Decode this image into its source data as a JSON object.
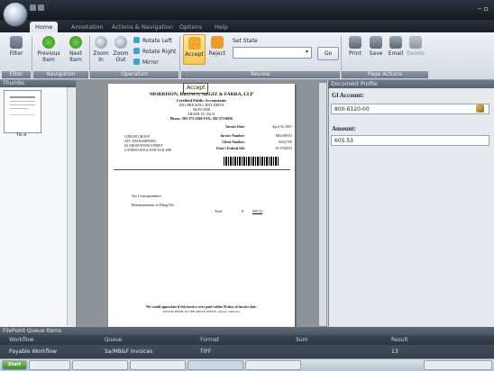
{
  "window": {
    "controls": "– ▫"
  },
  "tabs": [
    {
      "label": "Home"
    },
    {
      "label": "Annotation"
    },
    {
      "label": "Actions & Navigation"
    },
    {
      "label": "Options"
    },
    {
      "label": "Help"
    }
  ],
  "ribbon": {
    "groups": {
      "filter": "Filter",
      "navigation": "Navigation",
      "operation": "Operation",
      "review": "Review",
      "page_actions": "Page Actions"
    },
    "filter_label": "Filter",
    "previous_label": "Previous Item",
    "next_label": "Next Item",
    "zoom_in_label": "Zoom In",
    "zoom_out_label": "Zoom Out",
    "rotate_left_label": "Rotate Left",
    "rotate_right_label": "Rotate Right",
    "mirror_label": "Mirror",
    "accept_label": "Accept",
    "reject_label": "Reject",
    "set_state_label": "Set State",
    "go_label": "Go",
    "print_label": "Print",
    "save_label": "Save",
    "email_label": "Email",
    "delete_label": "Delete"
  },
  "thumbnails": {
    "header": "Thumbs",
    "item_label": "fa-a"
  },
  "tooltip": "Accept",
  "document": {
    "firm": "MORRISON, BROWN, ARGIZ & FARRA, LLP",
    "subtitle": "Certified Public Accountants",
    "addr1": "1001 BRICKELL BAY DRIVE",
    "addr2": "9th FLOOR",
    "addr3": "MIAMI, FL 33131",
    "phone": "Phone: 305-373-5500   FAX: 305-373-0056",
    "invoice_date_label": "Invoice Date:",
    "invoice_date": "April 30, 2007",
    "invoice_number_label": "Invoice Number:",
    "invoice_number": "M0e189553",
    "client_number_label": "Client Number:",
    "client_number": "02021700",
    "fed_id_label": "Firm's Federal Id#:",
    "fed_id": "65-0720052",
    "bill_to": [
      "COROM GROUP",
      "ATT: JIM RAMFORD",
      "60 GROSVENOR STREET",
      "LONDON ENGLAND W1K 3HP"
    ],
    "tax_line": "Tax Correspondence",
    "fee_line": "Reimbursement of Filing Fee",
    "total_label": "Total",
    "total_currency": "$",
    "total_amount": "605.53",
    "footer1": "We would appreciate if this invoice were paid within 30 days of invoice date.",
    "footer2": "PLEASE REMIT TO THE ABOVE OFFICE. Invoice Client No."
  },
  "profile": {
    "header": "Document Profile",
    "gl_label": "Gl Account:",
    "gl_value": "800-6120-00",
    "amount_label": "Amount:",
    "amount_value": "605.53"
  },
  "queue": {
    "title": "FilePoint Queue Items",
    "columns": [
      "Workflow",
      "Queue",
      "Format",
      "Sum",
      "Result"
    ],
    "row": [
      "Payable Workflow",
      "Sa/MB&F Invoices",
      "TIFF",
      "",
      "13"
    ]
  },
  "taskbar": {
    "start_label": "Start"
  },
  "colors": {
    "accent": "#f0a830",
    "ribbon": "#e3e8ee",
    "dark": "#2d3540"
  }
}
